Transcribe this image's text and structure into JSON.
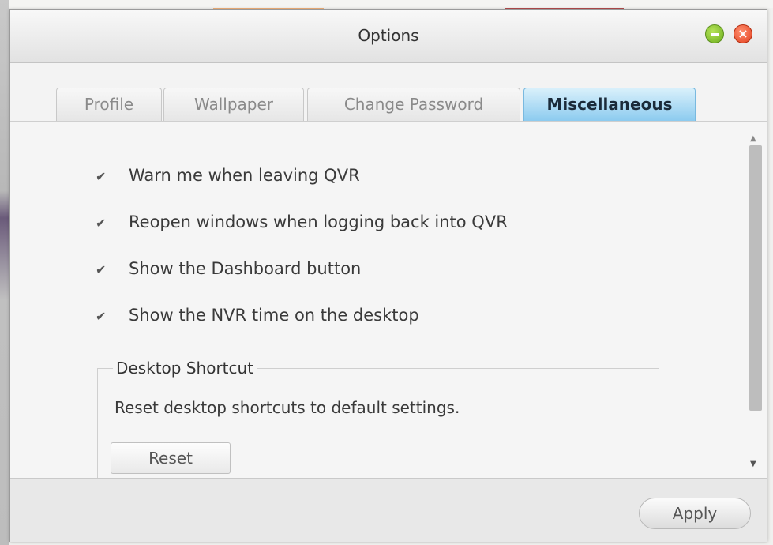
{
  "window": {
    "title": "Options"
  },
  "tabs": [
    {
      "label": "Profile",
      "active": false
    },
    {
      "label": "Wallpaper",
      "active": false
    },
    {
      "label": "Change Password",
      "active": false
    },
    {
      "label": "Miscellaneous",
      "active": true
    }
  ],
  "options": [
    {
      "label": "Warn me when leaving QVR",
      "checked": true
    },
    {
      "label": "Reopen windows when logging back into QVR",
      "checked": true
    },
    {
      "label": "Show the Dashboard button",
      "checked": true
    },
    {
      "label": "Show the NVR time on the desktop",
      "checked": true
    }
  ],
  "desktop_shortcut": {
    "title": "Desktop Shortcut",
    "description": "Reset desktop shortcuts to default settings.",
    "reset_label": "Reset"
  },
  "footer": {
    "apply_label": "Apply"
  },
  "icons": {
    "minimize": "minimize-icon",
    "close": "close-icon",
    "checkbox": "check-icon"
  },
  "colors": {
    "active_tab": "#8ccbef",
    "minimize_button": "#6aac1c",
    "close_button": "#e2401f"
  }
}
